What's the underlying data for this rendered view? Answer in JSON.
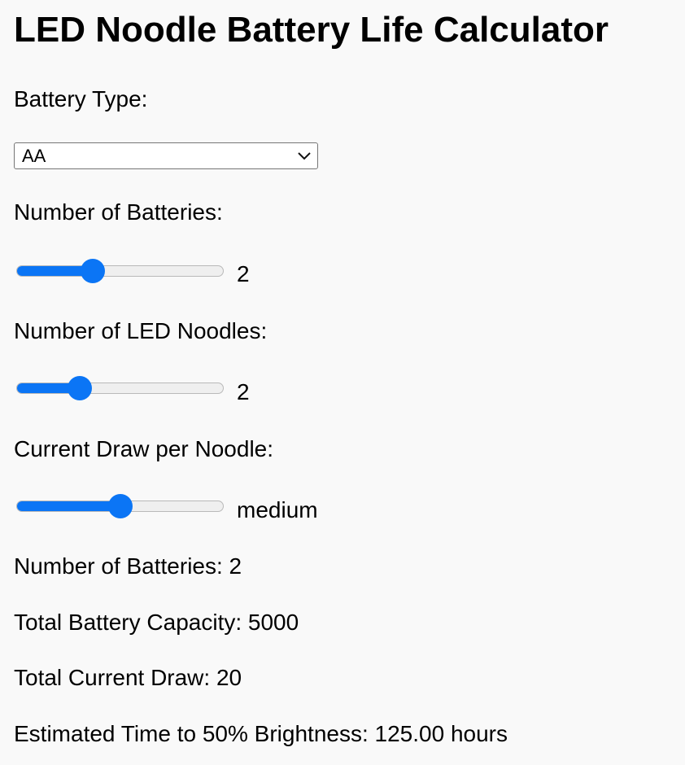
{
  "title": "LED Noodle Battery Life Calculator",
  "battery_type": {
    "label": "Battery Type:",
    "selected": "AA",
    "icon": "chevron-down-icon"
  },
  "num_batteries": {
    "label": "Number of Batteries:",
    "value": "2",
    "level": 0.35
  },
  "num_noodles": {
    "label": "Number of LED Noodles:",
    "value": "2",
    "level": 0.28
  },
  "current_draw": {
    "label": "Current Draw per Noodle:",
    "value": "medium",
    "level": 0.5
  },
  "results": {
    "num_batteries": "Number of Batteries: 2",
    "total_capacity": "Total Battery Capacity: 5000",
    "total_current": "Total Current Draw: 20",
    "estimated_time": "Estimated Time to 50% Brightness: 125.00 hours"
  },
  "colors": {
    "accent": "#0b75f5",
    "background": "#f9f9f9"
  }
}
